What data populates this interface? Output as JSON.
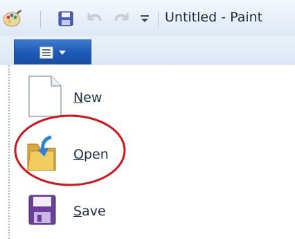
{
  "window": {
    "title": "Untitled - Paint"
  },
  "quick_access": {
    "icons": [
      "paint-app-icon",
      "save-icon",
      "undo-icon",
      "redo-icon",
      "customize-dropdown-icon"
    ]
  },
  "ribbon": {
    "app_button_icons": [
      "app-menu-icon",
      "chevron-down-icon"
    ]
  },
  "menu": {
    "items": [
      {
        "label": "New",
        "icon": "new-document-icon"
      },
      {
        "label": "Open",
        "icon": "open-folder-icon"
      },
      {
        "label": "Save",
        "icon": "floppy-disk-icon"
      }
    ]
  },
  "colors": {
    "app_button": "#1c58b4",
    "highlight_ring": "#d4141b",
    "title_text": "#1e2a3a"
  }
}
